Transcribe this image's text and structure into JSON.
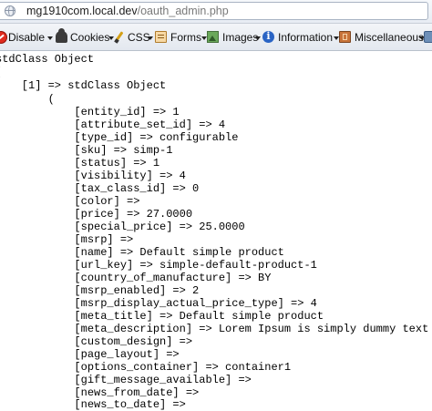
{
  "address_bar": {
    "host": "mg1910com.local.dev",
    "path": "/oauth_admin.php"
  },
  "toolbar": {
    "items": [
      {
        "label": "Disable",
        "icon": "no-entry-icon"
      },
      {
        "label": "Cookies",
        "icon": "cookie-user-icon"
      },
      {
        "label": "CSS",
        "icon": "pencil-icon"
      },
      {
        "label": "Forms",
        "icon": "form-icon"
      },
      {
        "label": "Images",
        "icon": "image-icon"
      },
      {
        "label": "Information",
        "icon": "info-icon"
      },
      {
        "label": "Miscellaneous",
        "icon": "book-icon"
      },
      {
        "label": "",
        "icon": "options-icon"
      }
    ]
  },
  "content": {
    "lines": [
      "stdClass Object",
      "(",
      "    [1] => stdClass Object",
      "        (",
      "            [entity_id] => 1",
      "            [attribute_set_id] => 4",
      "            [type_id] => configurable",
      "            [sku] => simp-1",
      "            [status] => 1",
      "            [visibility] => 4",
      "            [tax_class_id] => 0",
      "            [color] =>",
      "            [price] => 27.0000",
      "            [special_price] => 25.0000",
      "            [msrp] =>",
      "            [name] => Default simple product",
      "            [url_key] => simple-default-product-1",
      "            [country_of_manufacture] => BY",
      "            [msrp_enabled] => 2",
      "            [msrp_display_actual_price_type] => 4",
      "            [meta_title] => Default simple product",
      "            [meta_description] => Lorem Ipsum is simply dummy text",
      "            [custom_design] =>",
      "            [page_layout] =>",
      "            [options_container] => container1",
      "            [gift_message_available] =>",
      "            [news_from_date] =>",
      "            [news_to_date] =>"
    ]
  }
}
